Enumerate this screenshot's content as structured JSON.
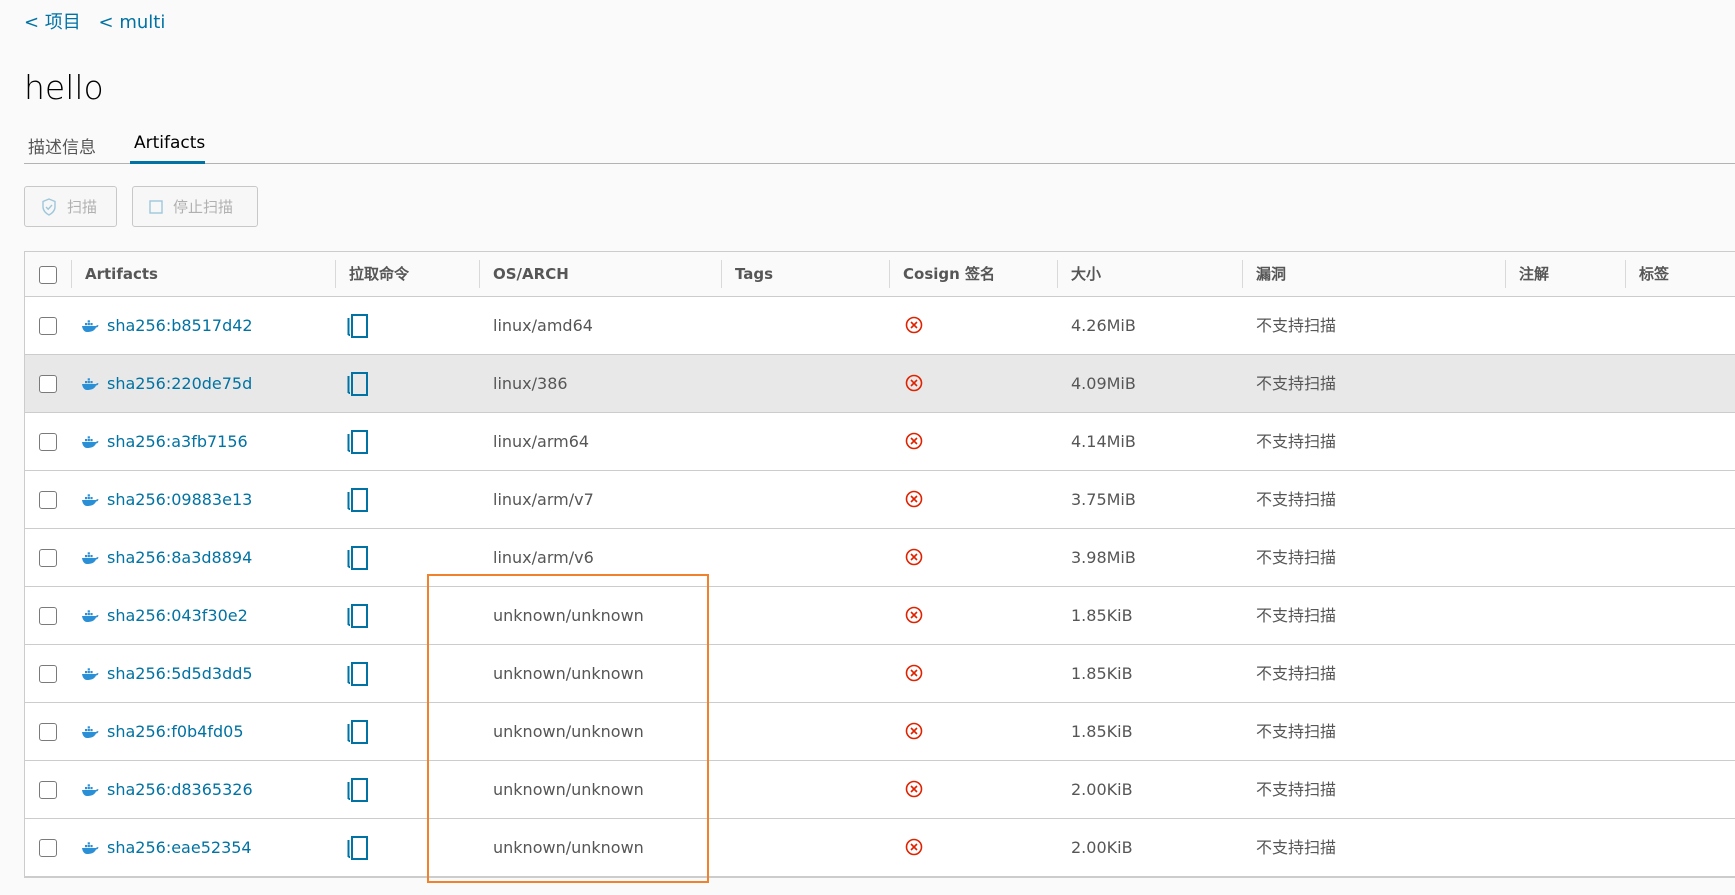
{
  "breadcrumb": [
    "< 项目",
    "< multi"
  ],
  "page_title": "hello",
  "tabs": [
    {
      "label": "描述信息",
      "active": false
    },
    {
      "label": "Artifacts",
      "active": true
    }
  ],
  "toolbar": {
    "scan_label": "扫描",
    "stop_scan_label": "停止扫描"
  },
  "table": {
    "columns": [
      "Artifacts",
      "拉取命令",
      "OS/ARCH",
      "Tags",
      "Cosign 签名",
      "大小",
      "漏洞",
      "注解",
      "标签"
    ],
    "rows": [
      {
        "digest": "sha256:b8517d42",
        "os_arch": "linux/amd64",
        "size": "4.26MiB",
        "vuln": "不支持扫描"
      },
      {
        "digest": "sha256:220de75d",
        "os_arch": "linux/386",
        "size": "4.09MiB",
        "vuln": "不支持扫描"
      },
      {
        "digest": "sha256:a3fb7156",
        "os_arch": "linux/arm64",
        "size": "4.14MiB",
        "vuln": "不支持扫描"
      },
      {
        "digest": "sha256:09883e13",
        "os_arch": "linux/arm/v7",
        "size": "3.75MiB",
        "vuln": "不支持扫描"
      },
      {
        "digest": "sha256:8a3d8894",
        "os_arch": "linux/arm/v6",
        "size": "3.98MiB",
        "vuln": "不支持扫描"
      },
      {
        "digest": "sha256:043f30e2",
        "os_arch": "unknown/unknown",
        "size": "1.85KiB",
        "vuln": "不支持扫描"
      },
      {
        "digest": "sha256:5d5d3dd5",
        "os_arch": "unknown/unknown",
        "size": "1.85KiB",
        "vuln": "不支持扫描"
      },
      {
        "digest": "sha256:f0b4fd05",
        "os_arch": "unknown/unknown",
        "size": "1.85KiB",
        "vuln": "不支持扫描"
      },
      {
        "digest": "sha256:d8365326",
        "os_arch": "unknown/unknown",
        "size": "2.00KiB",
        "vuln": "不支持扫描"
      },
      {
        "digest": "sha256:eae52354",
        "os_arch": "unknown/unknown",
        "size": "2.00KiB",
        "vuln": "不支持扫描"
      }
    ]
  },
  "colors": {
    "link": "#0072a3",
    "unsigned_icon": "#e12200",
    "annotation_box": "#f0822d",
    "hover_row": "#e8e8e8"
  },
  "icons": {
    "artifact": "docker-whale-icon",
    "pull": "copy-icon",
    "cosign": "x-circle-icon",
    "scan": "shield-icon",
    "stop": "square-icon"
  }
}
